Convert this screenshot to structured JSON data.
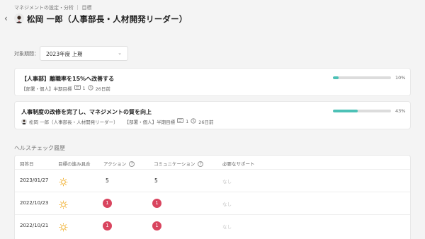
{
  "breadcrumb": "マネジメントの設定・分析 ｜ 目標",
  "page_title": "松岡 一郎（人事部長・人材開発リーダー）",
  "period": {
    "label": "対象期間：",
    "value": "2023年度 上期"
  },
  "goals": [
    {
      "title": "【人事部】離職率を15%へ改善する",
      "category": "【部署・個人】半期目標",
      "comments": "1",
      "updated": "26日前",
      "owner": "",
      "progress": 0.1,
      "progress_label": "10%"
    },
    {
      "title": "人事制度の改修を完了し、マネジメントの質を向上",
      "owner": "松岡 一郎（人事部長・人材開発リーダー）",
      "category": "【部署・個人】半期目標",
      "comments": "1",
      "updated": "26日前",
      "progress": 0.43,
      "progress_label": "43%"
    }
  ],
  "health": {
    "title": "ヘルスチェック履歴",
    "headers": {
      "date": "回答日",
      "status": "目標の進み具合",
      "action": "アクション",
      "communication": "コミュニケーション",
      "support": "必要なサポート",
      "help": "?"
    },
    "rows": [
      {
        "date": "2023/01/27",
        "status_icon": "sun-icon",
        "action": "5",
        "action_alert": false,
        "communication": "5",
        "communication_alert": false,
        "support": "なし"
      },
      {
        "date": "2022/10/23",
        "status_icon": "sun-icon",
        "action": "1",
        "action_alert": true,
        "communication": "1",
        "communication_alert": true,
        "support": "なし"
      },
      {
        "date": "2022/10/21",
        "status_icon": "sun-icon",
        "action": "1",
        "action_alert": true,
        "communication": "1",
        "communication_alert": true,
        "support": "なし"
      }
    ]
  },
  "colors": {
    "progress": "#4cc1b6",
    "alert": "#d9455f",
    "sun": "#f0b030"
  }
}
